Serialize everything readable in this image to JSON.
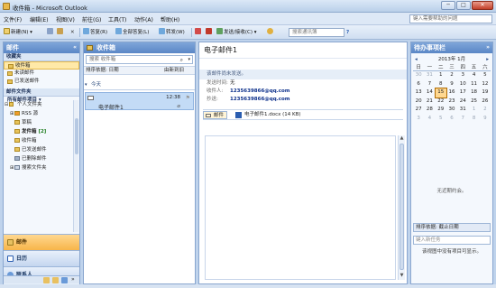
{
  "window": {
    "title": "收件箱 - Microsoft Outlook",
    "minimize": "─",
    "maximize": "□",
    "close": "✕"
  },
  "menu": {
    "items": [
      "文件(F)",
      "编辑(E)",
      "视图(V)",
      "前往(G)",
      "工具(T)",
      "动作(A)",
      "帮助(H)"
    ],
    "help_search_placeholder": "键入需要帮助的问题"
  },
  "toolbar": {
    "new": "新建(N)",
    "reply": "答复(R)",
    "reply_all": "全部答复(L)",
    "forward": "转发(W)",
    "send_receive": "发送/接收(C)",
    "contact_search_placeholder": "搜索通讯簿"
  },
  "nav": {
    "header": "邮件",
    "favorites_title": "收藏夹",
    "favorites": [
      "收件箱",
      "未读邮件",
      "已发送邮件"
    ],
    "all_folders_title": "邮件文件夹",
    "all_items": "所有邮件项目",
    "tree": [
      {
        "label": "个人文件夹",
        "count": ""
      },
      {
        "label": "RSS 源",
        "count": ""
      },
      {
        "label": "草稿",
        "count": ""
      },
      {
        "label": "发件箱",
        "count": "[2]"
      },
      {
        "label": "收件箱",
        "count": ""
      },
      {
        "label": "已发送邮件",
        "count": ""
      },
      {
        "label": "已删除邮件",
        "count": ""
      },
      {
        "label": "搜索文件夹",
        "count": ""
      }
    ],
    "buttons": [
      "邮件",
      "日历",
      "联系人",
      "任务"
    ]
  },
  "list": {
    "header": "收件箱",
    "search_placeholder": "搜索 收件箱",
    "sort_label": "排序依据: 日期",
    "sort_order": "由新到旧",
    "group": "今天",
    "items": [
      {
        "subject": "电子邮件1",
        "time": "12:38"
      }
    ]
  },
  "reading": {
    "subject": "电子邮件1",
    "info": "该邮件尚未发送。",
    "fields": [
      {
        "key": "发送时间:",
        "value": "无"
      },
      {
        "key": "收件人:",
        "value": "1235639866@qq.com"
      },
      {
        "key": "抄送:",
        "value": "1235639866@qq.com"
      }
    ],
    "attach_mail_label": "邮件",
    "attachment": "电子邮件1.docx (14 KB)"
  },
  "todo": {
    "header": "待办事项栏",
    "month": "2013年 1月",
    "dow": [
      "日",
      "一",
      "二",
      "三",
      "四",
      "五",
      "六"
    ],
    "weeks": [
      [
        "30",
        "31",
        "1",
        "2",
        "3",
        "4",
        "5"
      ],
      [
        "6",
        "7",
        "8",
        "9",
        "10",
        "11",
        "12"
      ],
      [
        "13",
        "14",
        "15",
        "16",
        "17",
        "18",
        "19"
      ],
      [
        "20",
        "21",
        "22",
        "23",
        "24",
        "25",
        "26"
      ],
      [
        "27",
        "28",
        "29",
        "30",
        "31",
        "1",
        "2"
      ],
      [
        "3",
        "4",
        "5",
        "6",
        "7",
        "8",
        "9"
      ]
    ],
    "no_appointments": "无近期约会。",
    "task_sort": "排序依据: 截止日期",
    "task_input_placeholder": "键入新任务",
    "task_empty": "该视图中没有项目可显示。"
  }
}
